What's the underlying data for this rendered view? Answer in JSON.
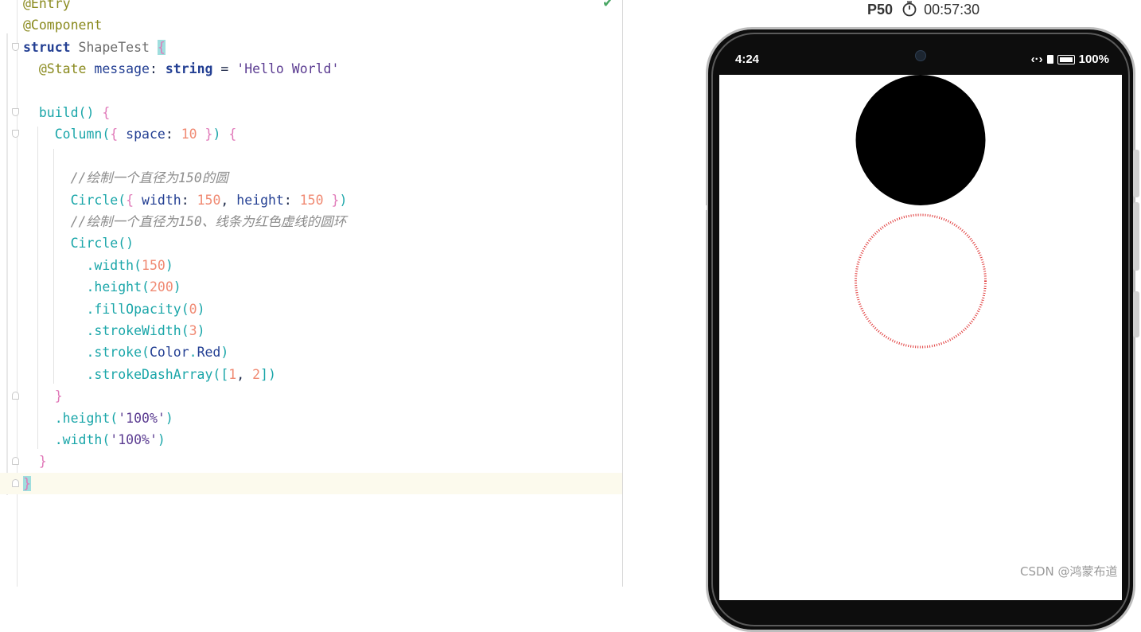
{
  "editor": {
    "lines": [
      {
        "tokens": [
          {
            "t": "@Entry",
            "c": "ann"
          }
        ]
      },
      {
        "tokens": [
          {
            "t": "@Component",
            "c": "ann"
          }
        ]
      },
      {
        "tokens": [
          {
            "t": "struct",
            "c": "kw"
          },
          {
            "t": " ShapeTest ",
            "c": "cls"
          },
          {
            "t": "{",
            "c": "brace hlb"
          }
        ]
      },
      {
        "tokens": [
          {
            "t": "  @State",
            "c": "ann"
          },
          {
            "t": " message",
            "c": "prop"
          },
          {
            "t": ": ",
            "c": "punc"
          },
          {
            "t": "string",
            "c": "kw"
          },
          {
            "t": " = ",
            "c": "punc"
          },
          {
            "t": "'Hello World'",
            "c": "str"
          }
        ]
      },
      {
        "tokens": []
      },
      {
        "tokens": [
          {
            "t": "  build",
            "c": "fn"
          },
          {
            "t": "() ",
            "c": "pun2"
          },
          {
            "t": "{",
            "c": "brace"
          }
        ]
      },
      {
        "tokens": [
          {
            "t": "    Column",
            "c": "fn"
          },
          {
            "t": "(",
            "c": "pun2"
          },
          {
            "t": "{",
            "c": "brace"
          },
          {
            "t": " space",
            "c": "prop"
          },
          {
            "t": ": ",
            "c": "punc"
          },
          {
            "t": "10",
            "c": "num"
          },
          {
            "t": " ",
            "c": "punc"
          },
          {
            "t": "}",
            "c": "brace"
          },
          {
            "t": ") ",
            "c": "pun2"
          },
          {
            "t": "{",
            "c": "brace"
          }
        ]
      },
      {
        "tokens": []
      },
      {
        "tokens": [
          {
            "t": "      //绘制一个直径为150的圆",
            "c": "cmt"
          }
        ]
      },
      {
        "tokens": [
          {
            "t": "      Circle",
            "c": "fn"
          },
          {
            "t": "(",
            "c": "pun2"
          },
          {
            "t": "{",
            "c": "brace"
          },
          {
            "t": " width",
            "c": "prop"
          },
          {
            "t": ": ",
            "c": "punc"
          },
          {
            "t": "150",
            "c": "num"
          },
          {
            "t": ", ",
            "c": "punc"
          },
          {
            "t": "height",
            "c": "prop"
          },
          {
            "t": ": ",
            "c": "punc"
          },
          {
            "t": "150",
            "c": "num"
          },
          {
            "t": " ",
            "c": "punc"
          },
          {
            "t": "}",
            "c": "brace"
          },
          {
            "t": ")",
            "c": "pun2"
          }
        ]
      },
      {
        "tokens": [
          {
            "t": "      //绘制一个直径为150、线条为红色虚线的圆环",
            "c": "cmt"
          }
        ]
      },
      {
        "tokens": [
          {
            "t": "      Circle",
            "c": "fn"
          },
          {
            "t": "()",
            "c": "pun2"
          }
        ]
      },
      {
        "tokens": [
          {
            "t": "        .width",
            "c": "fn"
          },
          {
            "t": "(",
            "c": "pun2"
          },
          {
            "t": "150",
            "c": "num"
          },
          {
            "t": ")",
            "c": "pun2"
          }
        ]
      },
      {
        "tokens": [
          {
            "t": "        .height",
            "c": "fn"
          },
          {
            "t": "(",
            "c": "pun2"
          },
          {
            "t": "200",
            "c": "num"
          },
          {
            "t": ")",
            "c": "pun2"
          }
        ]
      },
      {
        "tokens": [
          {
            "t": "        .fillOpacity",
            "c": "fn"
          },
          {
            "t": "(",
            "c": "pun2"
          },
          {
            "t": "0",
            "c": "num"
          },
          {
            "t": ")",
            "c": "pun2"
          }
        ]
      },
      {
        "tokens": [
          {
            "t": "        .strokeWidth",
            "c": "fn"
          },
          {
            "t": "(",
            "c": "pun2"
          },
          {
            "t": "3",
            "c": "num"
          },
          {
            "t": ")",
            "c": "pun2"
          }
        ]
      },
      {
        "tokens": [
          {
            "t": "        .stroke",
            "c": "fn"
          },
          {
            "t": "(",
            "c": "pun2"
          },
          {
            "t": "Color",
            "c": "prop"
          },
          {
            "t": ".",
            "c": "pun2"
          },
          {
            "t": "Red",
            "c": "prop"
          },
          {
            "t": ")",
            "c": "pun2"
          }
        ]
      },
      {
        "tokens": [
          {
            "t": "        .strokeDashArray",
            "c": "fn"
          },
          {
            "t": "([",
            "c": "pun2"
          },
          {
            "t": "1",
            "c": "num"
          },
          {
            "t": ", ",
            "c": "punc"
          },
          {
            "t": "2",
            "c": "num"
          },
          {
            "t": "])",
            "c": "pun2"
          }
        ]
      },
      {
        "tokens": [
          {
            "t": "    }",
            "c": "brace"
          }
        ]
      },
      {
        "tokens": [
          {
            "t": "    .height",
            "c": "fn"
          },
          {
            "t": "(",
            "c": "pun2"
          },
          {
            "t": "'100%'",
            "c": "str"
          },
          {
            "t": ")",
            "c": "pun2"
          }
        ]
      },
      {
        "tokens": [
          {
            "t": "    .width",
            "c": "fn"
          },
          {
            "t": "(",
            "c": "pun2"
          },
          {
            "t": "'100%'",
            "c": "str"
          },
          {
            "t": ")",
            "c": "pun2"
          }
        ]
      },
      {
        "tokens": [
          {
            "t": "  }",
            "c": "brace"
          }
        ]
      },
      {
        "tokens": [
          {
            "t": "}",
            "c": "brace hlb"
          }
        ]
      }
    ],
    "fold_start_lines": [
      2,
      5,
      6
    ],
    "fold_end_lines": [
      18,
      21,
      22
    ],
    "current_line": 22
  },
  "preview": {
    "device_name": "P50",
    "timer": "00:57:30",
    "status_time": "4:24",
    "status_battery": "100%",
    "status_data_icon": "‹·›",
    "circle1": {
      "width": 150,
      "height": 150,
      "fill": "#000000"
    },
    "circle2": {
      "width": 150,
      "height": 200,
      "fill_opacity": 0,
      "stroke_width": 3,
      "stroke": "#e03a3a",
      "dash_array": [
        1,
        2
      ]
    },
    "column_space": 10
  },
  "watermark": "CSDN @鸿蒙布道",
  "colors": {
    "check": "#4aa765",
    "current_line_bg": "#fcfaed",
    "bracket_highlight": "#9fdede"
  }
}
